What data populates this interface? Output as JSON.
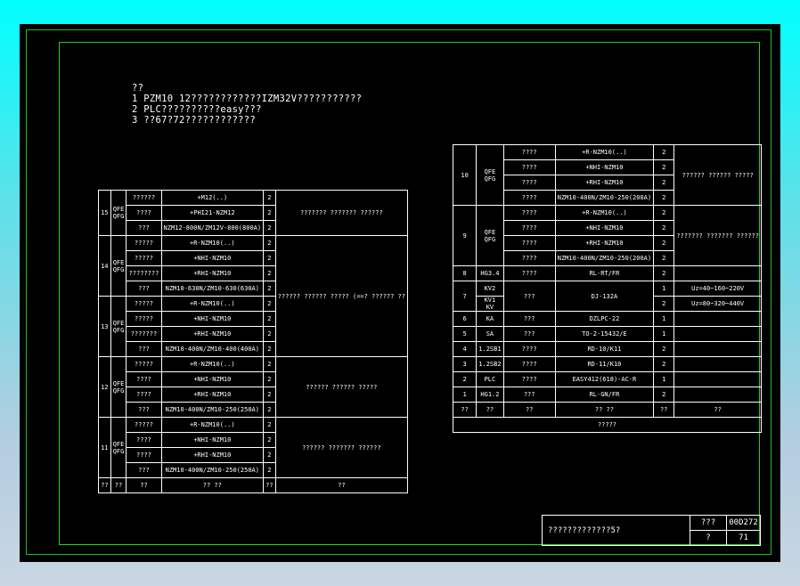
{
  "notes": {
    "heading": "??",
    "line1": "1 PZM10 12????????????IZM32V???????????",
    "line2": "2 PLC??????????easy???",
    "line3": "3 ??67?72????????????"
  },
  "left_table": {
    "groups": [
      {
        "no": "15",
        "code": "QFE\nQFG",
        "remark": "???????\n???????\n??????",
        "rows": [
          [
            "??????",
            "+M12(..)",
            "2"
          ],
          [
            "????",
            "+PHI21-NZM12",
            "2"
          ],
          [
            "???",
            "NZM12-800N/ZM12V-800(800A)",
            "2"
          ]
        ]
      },
      {
        "no": "14",
        "code": "QFE\nQFG",
        "remark": "??????\n??????\n?????\n(==?\n??????\n??",
        "rows": [
          [
            "?????",
            "+R-NZM10(..)",
            "2"
          ],
          [
            "?????",
            "+NHI-NZM10",
            "2"
          ],
          [
            "????????",
            "+RHI-NZM10",
            "2"
          ],
          [
            "???",
            "NZM10-630N/ZM10-630(630A)",
            "2"
          ]
        ]
      },
      {
        "no": "13",
        "code": "QFE\nQFG",
        "remark": "",
        "rows": [
          [
            "?????",
            "+R-NZM10(..)",
            "2"
          ],
          [
            "?????",
            "+NHI-NZM10",
            "2"
          ],
          [
            "???????",
            "+RHI-NZM10",
            "2"
          ],
          [
            "???",
            "NZM10-400N/ZM10-400(400A)",
            "2"
          ]
        ]
      },
      {
        "no": "12",
        "code": "QFE\nQFG",
        "remark": "??????\n??????\n?????",
        "rows": [
          [
            "?????",
            "+R-NZM10(..)",
            "2"
          ],
          [
            "????",
            "+NHI-NZM10",
            "2"
          ],
          [
            "????",
            "+RHI-NZM10",
            "2"
          ],
          [
            "???",
            "NZM10-400N/ZM10-250(250A)",
            "2"
          ]
        ]
      },
      {
        "no": "11",
        "code": "QFE\nQFG",
        "remark": "??????\n???????\n??????",
        "rows": [
          [
            "?????",
            "+R-NZM10(..)",
            "2"
          ],
          [
            "????",
            "+NHI-NZM10",
            "2"
          ],
          [
            "????",
            "+RHI-NZM10",
            "2"
          ],
          [
            "???",
            "NZM10-400N/ZM10-250(250A)",
            "2"
          ]
        ]
      }
    ],
    "header": [
      "??",
      "??",
      "??",
      "??  ??",
      "??",
      "??"
    ]
  },
  "right_table": {
    "group10": {
      "no": "10",
      "code": "QFE\nQFG",
      "remark": "??????\n??????\n?????",
      "rows": [
        [
          "????",
          "+R-NZM10(..)",
          "2"
        ],
        [
          "????",
          "+NHI-NZM10",
          "2"
        ],
        [
          "????",
          "+RHI-NZM10",
          "2"
        ],
        [
          "????",
          "NZM10-400N/ZM10-250(200A)",
          "2"
        ]
      ]
    },
    "group9": {
      "no": "9",
      "code": "QFE\nQFG",
      "remark": "???????\n???????\n??????",
      "rows": [
        [
          "????",
          "+R-NZM10(..)",
          "2"
        ],
        [
          "????",
          "+NHI-NZM10",
          "2"
        ],
        [
          "????",
          "+RHI-NZM10",
          "2"
        ],
        [
          "????",
          "NZM10-400N/ZM10-250(200A)",
          "2"
        ]
      ]
    },
    "row8": [
      "8",
      "HG3.4",
      "????",
      "RL-RT/FR",
      "2",
      ""
    ],
    "row7": {
      "no": "7",
      "code_a": "KV2",
      "code_b": "KV1\nKV",
      "name": "???",
      "model": "DJ-132A",
      "qty_a": "1",
      "remark_a": "Uz=40~160~220V",
      "qty_b": "2",
      "remark_b": "Uz=80~320~440V"
    },
    "simple_rows": [
      [
        "6",
        "KA",
        "???",
        "DZLPC-22",
        "1",
        ""
      ],
      [
        "5",
        "SA",
        "???",
        "TO-2-15432/E",
        "1",
        ""
      ],
      [
        "4",
        "1.2SB1",
        "????",
        "RD-10/K11",
        "2",
        ""
      ],
      [
        "3",
        "1.2SB2",
        "????",
        "RD-11/K10",
        "2",
        ""
      ],
      [
        "2",
        "PLC",
        "????",
        "EASY412(618)-AC-R",
        "1",
        ""
      ],
      [
        "1",
        "HG1.2",
        "???",
        "RL-GN/FR",
        "2",
        ""
      ]
    ],
    "header": [
      "??",
      "??",
      "??",
      "??   ??",
      "??",
      "??"
    ],
    "footer": "?????"
  },
  "title_block": {
    "title": "?????????????5?",
    "label_a": "???",
    "code": "00D272",
    "label_b": "?",
    "page": "71"
  }
}
